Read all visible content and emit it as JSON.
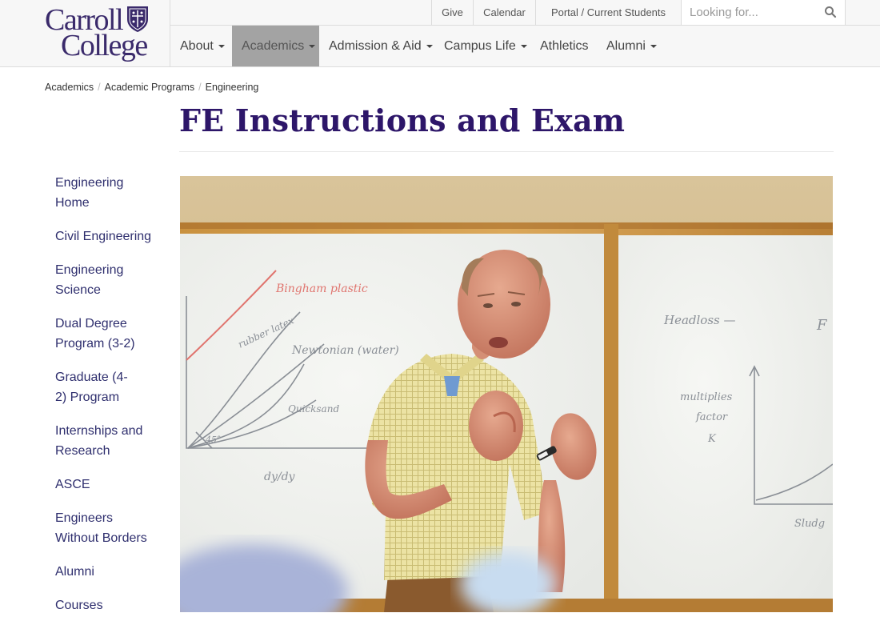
{
  "brand": {
    "line1": "Carroll",
    "line2": "College"
  },
  "util_nav": {
    "give": "Give",
    "calendar": "Calendar",
    "portal": "Portal / Current Students"
  },
  "search": {
    "placeholder": "Looking for..."
  },
  "main_nav": [
    {
      "label": "About",
      "dropdown": true
    },
    {
      "label": "Academics",
      "dropdown": true,
      "active": true
    },
    {
      "label": "Admission & Aid",
      "dropdown": true
    },
    {
      "label": "Campus Life",
      "dropdown": true
    },
    {
      "label": "Athletics",
      "dropdown": false
    },
    {
      "label": "Alumni",
      "dropdown": true
    }
  ],
  "breadcrumb": [
    "Academics",
    "Academic Programs",
    "Engineering"
  ],
  "page": {
    "title": "FE Instructions and Exam"
  },
  "sidebar": {
    "items": [
      "Engineering Home",
      "Civil Engineering",
      "Engineering Science",
      "Dual Degree Program (3-2)",
      "Graduate (4-2) Program",
      "Internships and Research",
      "ASCE",
      "Engineers Without Borders",
      "Alumni",
      "Courses"
    ]
  },
  "whiteboard": {
    "left": [
      "Bingham plastic",
      "rubber latex",
      "Newtonian (water)",
      "Quicksand",
      "45°",
      "dy/dy"
    ],
    "right": [
      "Headloss —",
      "F",
      "multiplies",
      "factor",
      "K",
      "Sludg"
    ]
  },
  "colors": {
    "brand_purple": "#2d1669",
    "link": "#2f2f6e",
    "nav_active_bg": "#a3a3a3"
  }
}
